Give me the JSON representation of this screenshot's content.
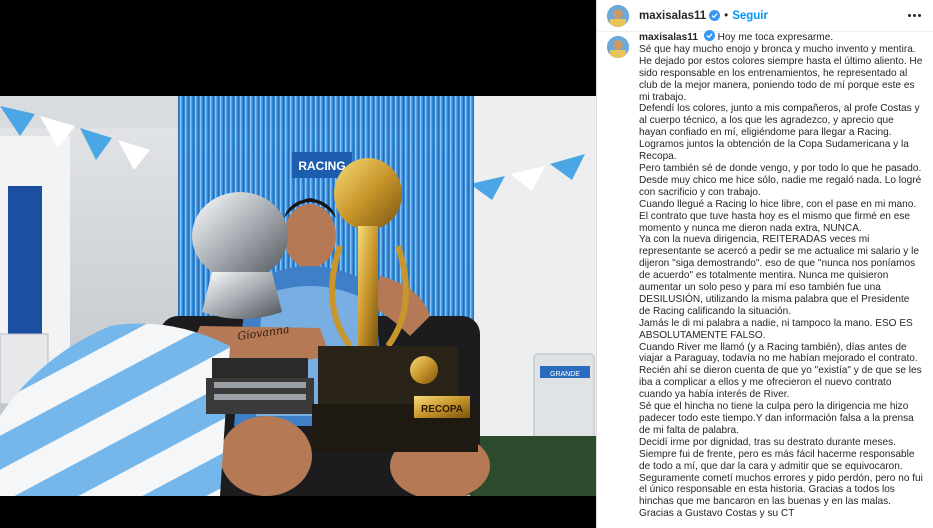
{
  "post": {
    "username": "maxisalas11",
    "follow_label": "Seguir",
    "trophy_plaque": "RECOPA",
    "banner_text": "RACING",
    "arm_tattoo": "Giovanna",
    "cooler_brand": "GRANDE",
    "caption_lines": [
      "Hoy me toca expresarme.",
      "Sé que hay mucho enojo y bronca y mucho invento y mentira.",
      "He dejado por estos colores siempre hasta el último aliento. He sido responsable en los entrenamientos, he representado al club de la mejor manera, poniendo todo de mí porque este es mi trabajo.",
      "Defendí los colores, junto a mis compañeros, al profe Costas y al cuerpo técnico, a los que les agradezco, y aprecio que hayan confiado en mí, eligiéndome para llegar a Racing.",
      "Logramos juntos la obtención de la Copa Sudamericana y la Recopa.",
      "Pero también sé de donde vengo, y por todo lo que he pasado.",
      "Desde muy chico me hice sólo, nadie me regaló nada. Lo logré con sacrificio y con trabajo.",
      "Cuando llegué a Racing lo hice libre, con el pase en mi mano. El contrato que tuve hasta hoy es el mismo que firmé en ese momento y nunca me dieron nada extra, NUNCA.",
      "Ya con la nueva dirigencia, REITERADAS veces mi representante se acercó a pedir se me actualice mi salario y le dijeron \"siga demostrando\". eso de que \"nunca nos poníamos de acuerdo\" es totalmente mentira. Nunca me quisieron aumentar un solo peso y para mí eso también fue una DESILUSIÓN, utilizando la misma palabra que el Presidente de Racing calificando la situación.",
      "Jamás le di mi palabra a nadie, ni tampoco la mano. ESO ES ABSOLUTAMENTE FALSO.",
      "Cuando River me llamó (y a Racing también), días antes de viajar a Paraguay, todavía no me habían mejorado el contrato.",
      "Recién ahí se dieron cuenta de que yo \"existía\" y de que se les iba a complicar a ellos y me ofrecieron el nuevo contrato cuando ya había interés de River.",
      "Sé que el hincha no tiene la culpa pero la dirigencia me hizo padecer todo este tiempo.Y dan información falsa a la prensa de mi falta de palabra.",
      "Decidí irme por dignidad, tras su destrato durante meses.",
      "Siempre fui de frente, pero es más fácil hacerme responsable de todo a mí, que dar la cara y admitir que se equivocaron.",
      "Seguramente cometí muchos errores y pido perdón, pero no fui el único responsable en esta historia. Gracias a todos los hinchas que me bancaron en las buenas y en las malas.",
      "Gracias a Gustavo Costas y su CT"
    ]
  },
  "colors": {
    "follow": "#0095f6",
    "text": "#262626",
    "verified": "#3897f0"
  }
}
